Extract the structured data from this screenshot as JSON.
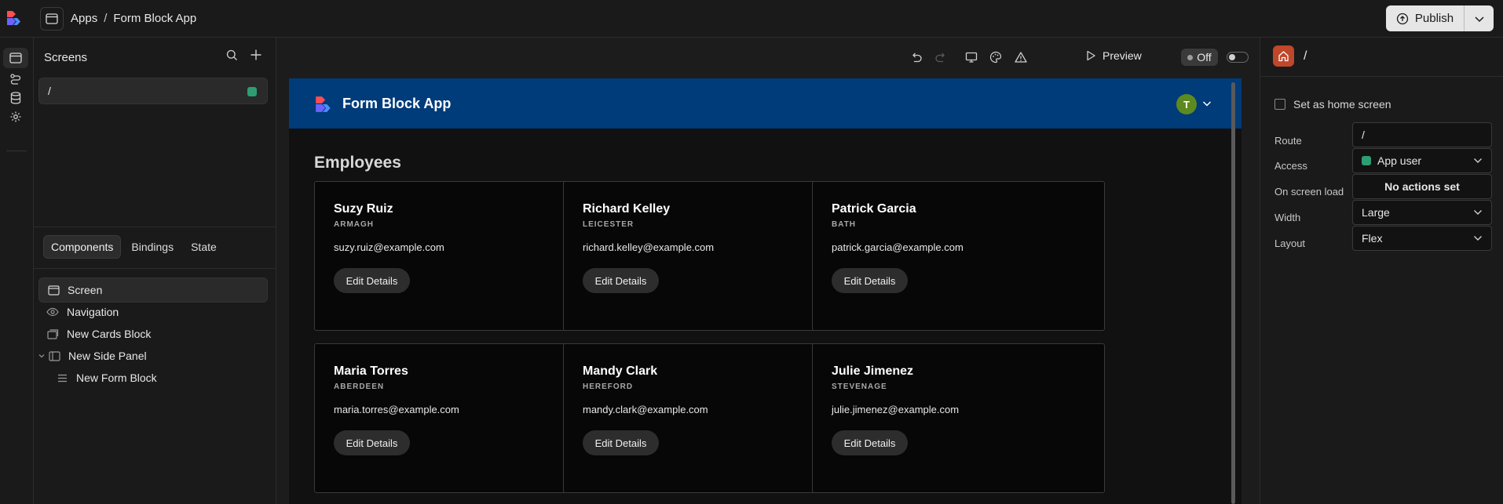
{
  "topbar": {
    "breadcrumb": [
      "Apps",
      "/",
      "Form Block App"
    ],
    "publish_label": "Publish"
  },
  "screens_panel": {
    "title": "Screens",
    "items": [
      {
        "label": "/"
      }
    ]
  },
  "tabs": [
    "Components",
    "Bindings",
    "State"
  ],
  "components": [
    {
      "label": "Screen",
      "icon": "screen-icon"
    },
    {
      "label": "Navigation",
      "icon": "eye-icon"
    },
    {
      "label": "New Cards Block",
      "icon": "cards-icon"
    },
    {
      "label": "New Side Panel",
      "icon": "side-panel-icon"
    },
    {
      "label": "New Form Block",
      "icon": "form-icon"
    }
  ],
  "toolbar": {
    "preview_label": "Preview",
    "off_label": "Off"
  },
  "app": {
    "title": "Form Block App",
    "avatar_initial": "T",
    "heading": "Employees",
    "nav_color": "#003b7a",
    "employees": [
      {
        "name": "Suzy Ruiz",
        "city": "ARMAGH",
        "email": "suzy.ruiz@example.com",
        "button": "Edit Details"
      },
      {
        "name": "Richard Kelley",
        "city": "LEICESTER",
        "email": "richard.kelley@example.com",
        "button": "Edit Details"
      },
      {
        "name": "Patrick Garcia",
        "city": "BATH",
        "email": "patrick.garcia@example.com",
        "button": "Edit Details"
      },
      {
        "name": "Maria Torres",
        "city": "ABERDEEN",
        "email": "maria.torres@example.com",
        "button": "Edit Details"
      },
      {
        "name": "Mandy Clark",
        "city": "HEREFORD",
        "email": "mandy.clark@example.com",
        "button": "Edit Details"
      },
      {
        "name": "Julie Jimenez",
        "city": "STEVENAGE",
        "email": "julie.jimenez@example.com",
        "button": "Edit Details"
      }
    ]
  },
  "settings": {
    "route_title": "/",
    "home_checkbox_label": "Set as home screen",
    "route_label": "Route",
    "route_value": "/",
    "access_label": "Access",
    "access_value": "App user",
    "on_load_label": "On screen load",
    "on_load_value": "No actions set",
    "width_label": "Width",
    "width_value": "Large",
    "layout_label": "Layout",
    "layout_value": "Flex"
  },
  "colors": {
    "accent_green": "#2e9d72",
    "home_button": "#c0472a",
    "avatar": "#5d8a1e"
  }
}
